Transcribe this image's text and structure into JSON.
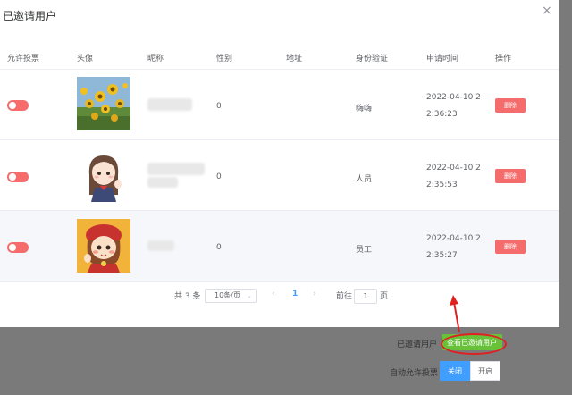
{
  "dialog": {
    "title": "已邀请用户",
    "close_glyph": "×"
  },
  "table": {
    "headers": [
      "允许投票",
      "头像",
      "昵称",
      "性别",
      "地址",
      "身份验证",
      "申请时间",
      "操作"
    ],
    "rows": [
      {
        "gender": "0",
        "identity": "嗨嗨",
        "time": "2022-04-10 22:36:23",
        "action": "删除"
      },
      {
        "gender": "0",
        "identity": "人员",
        "time": "2022-04-10 22:35:53",
        "action": "删除"
      },
      {
        "gender": "0",
        "identity": "员工",
        "time": "2022-04-10 22:35:27",
        "action": "删除"
      }
    ]
  },
  "pagination": {
    "total": "共 3 条",
    "page_size": "10条/页",
    "prev": "‹",
    "current": "1",
    "next": "›",
    "goto_label": "前往",
    "goto_value": "1",
    "page_suffix": "页"
  },
  "bottom": {
    "invited_label": "已邀请用户",
    "view_button": "查看已邀请用户",
    "auto_vote_label": "自动允许投票",
    "close_option": "关闭",
    "open_option": "开启"
  },
  "colors": {
    "danger": "#f56c6c",
    "success": "#67c23a",
    "primary": "#409eff",
    "annotation": "#e02020"
  }
}
